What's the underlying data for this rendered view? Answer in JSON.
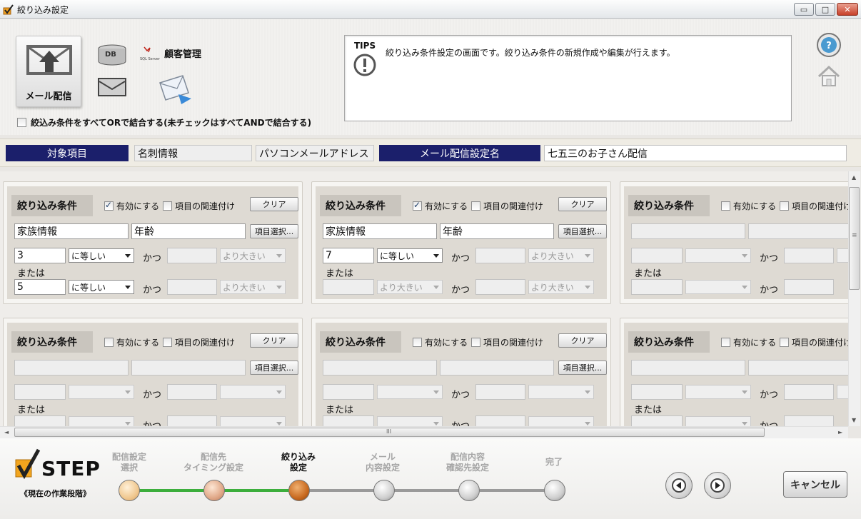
{
  "window": {
    "title": "絞り込み設定",
    "minimize_glyph": "▭",
    "maximize_glyph": "□",
    "close_glyph": "✕"
  },
  "header": {
    "mail_tile_label": "メール配信",
    "db_badge": "DB",
    "sql_brand": "SQL Server",
    "customer_mgmt": "顧客管理",
    "tips_label": "TIPS",
    "tips_text": "絞り込み条件設定の画面です。絞り込み条件の新規作成や編集が行えます。",
    "or_checkbox_label": "絞込み条件をすべてORで結合する(未チェックはすべてANDで結合する)",
    "help_icon": "help-icon",
    "home_icon": "home-icon"
  },
  "target": {
    "label": "対象項目",
    "value1": "名刺情報",
    "value2": "パソコンメールアドレス",
    "setting_label": "メール配信設定名",
    "setting_value": "七五三のお子さん配信"
  },
  "panels": [
    {
      "title": "絞り込み条件",
      "enable_label": "有効にする",
      "enabled": true,
      "link_label": "項目の関連付け",
      "clear_label": "クリア",
      "field1": "家族情報",
      "field2": "年齢",
      "select_label": "項目選択...",
      "v1": "3",
      "op1": "に等しい",
      "and_label": "かつ",
      "v2": "",
      "op2": "より大きい",
      "or_label": "または",
      "v3": "5",
      "op3": "に等しい",
      "v4": "",
      "op4": "より大きい"
    },
    {
      "title": "絞り込み条件",
      "enable_label": "有効にする",
      "enabled": true,
      "link_label": "項目の関連付け",
      "clear_label": "クリア",
      "field1": "家族情報",
      "field2": "年齢",
      "select_label": "項目選択...",
      "v1": "7",
      "op1": "に等しい",
      "and_label": "かつ",
      "v2": "",
      "op2": "より大きい",
      "or_label": "または",
      "v3": "",
      "op3": "より大きい",
      "v4": "",
      "op4": "より大きい"
    },
    {
      "title": "絞り込み条件",
      "enable_label": "有効にする",
      "enabled": false,
      "link_label": "項目の関連付け",
      "clear_label": "",
      "field1": "",
      "field2": "",
      "select_label": "",
      "v1": "",
      "op1": "",
      "and_label": "かつ",
      "v2": "",
      "op2": "",
      "or_label": "または",
      "v3": "",
      "op3": "",
      "v4": "",
      "op4": ""
    },
    {
      "title": "絞り込み条件",
      "enable_label": "有効にする",
      "enabled": false,
      "link_label": "項目の関連付け",
      "clear_label": "クリア",
      "field1": "",
      "field2": "",
      "select_label": "項目選択...",
      "v1": "",
      "op1": "",
      "and_label": "かつ",
      "v2": "",
      "op2": "",
      "or_label": "または",
      "v3": "",
      "op3": "",
      "v4": "",
      "op4": ""
    },
    {
      "title": "絞り込み条件",
      "enable_label": "有効にする",
      "enabled": false,
      "link_label": "項目の関連付け",
      "clear_label": "クリア",
      "field1": "",
      "field2": "",
      "select_label": "項目選択...",
      "v1": "",
      "op1": "",
      "and_label": "かつ",
      "v2": "",
      "op2": "",
      "or_label": "または",
      "v3": "",
      "op3": "",
      "v4": "",
      "op4": ""
    },
    {
      "title": "絞り込み条件",
      "enable_label": "有効にする",
      "enabled": false,
      "link_label": "項目の関連付け",
      "clear_label": "",
      "field1": "",
      "field2": "",
      "select_label": "",
      "v1": "",
      "op1": "",
      "and_label": "かつ",
      "v2": "",
      "op2": "",
      "or_label": "または",
      "v3": "",
      "op3": "",
      "v4": "",
      "op4": ""
    }
  ],
  "scroll": {
    "hgrip": "III",
    "vgrip": "≡",
    "up": "▲",
    "down": "▼",
    "left": "◄",
    "right": "►"
  },
  "footer": {
    "step_word": "STEP",
    "step_sub": "《現在の作業段階》",
    "steps": [
      {
        "line1": "配信設定",
        "line2": "選択",
        "state": "done"
      },
      {
        "line1": "配信先",
        "line2": "タイミング設定",
        "state": "done"
      },
      {
        "line1": "絞り込み",
        "line2": "設定",
        "state": "current"
      },
      {
        "line1": "メール",
        "line2": "内容設定",
        "state": "todo"
      },
      {
        "line1": "配信内容",
        "line2": "確認先設定",
        "state": "todo"
      },
      {
        "line1": "完了",
        "line2": "",
        "state": "todo"
      }
    ],
    "cancel_label": "キャンセル"
  },
  "colors": {
    "navy": "#1b1f6b",
    "progress_green": "#3cae3c",
    "current_step": "#c86a20"
  }
}
